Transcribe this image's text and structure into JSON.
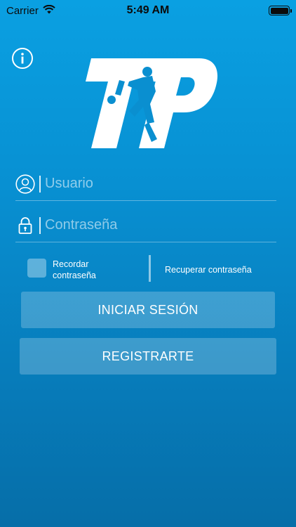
{
  "status_bar": {
    "carrier": "Carrier",
    "time": "5:49 AM"
  },
  "icons": {
    "info": "info-icon",
    "user": "user-icon",
    "lock": "lock-icon",
    "wifi": "wifi-icon",
    "battery": "battery-icon",
    "logo": "tp-logo"
  },
  "logo_text": "TP",
  "login": {
    "username_placeholder": "Usuario",
    "password_placeholder": "Contraseña",
    "remember_label": "Recordar contraseña",
    "recover_link": "Recuperar contraseña",
    "login_button": "INICIAR SESIÓN",
    "register_button": "REGISTRARTE"
  },
  "colors": {
    "background_top": "#0aa0e2",
    "background_bottom": "#066ea8",
    "text": "#ffffff"
  }
}
